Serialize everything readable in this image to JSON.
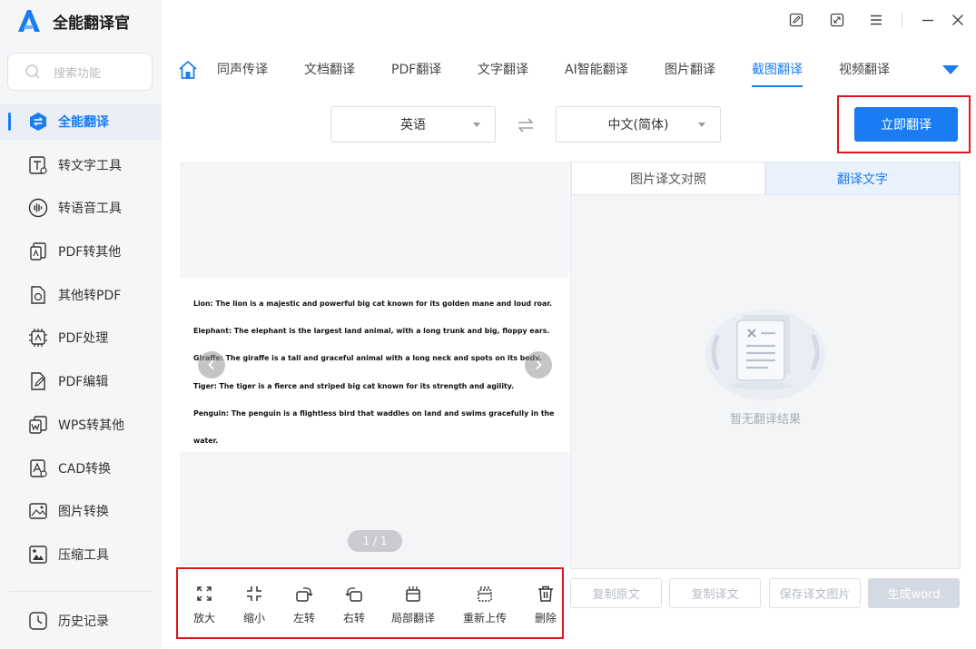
{
  "app": {
    "title": "全能翻译官"
  },
  "search": {
    "placeholder": "搜索功能"
  },
  "sidebar": {
    "items": [
      {
        "label": "全能翻译",
        "icon": "translate-icon",
        "active": true
      },
      {
        "label": "转文字工具",
        "icon": "text-convert-icon"
      },
      {
        "label": "转语音工具",
        "icon": "voice-icon"
      },
      {
        "label": "PDF转其他",
        "icon": "pdf-convert-icon"
      },
      {
        "label": "其他转PDF",
        "icon": "to-pdf-icon"
      },
      {
        "label": "PDF处理",
        "icon": "pdf-process-icon"
      },
      {
        "label": "PDF编辑",
        "icon": "pdf-edit-icon"
      },
      {
        "label": "WPS转其他",
        "icon": "wps-icon"
      },
      {
        "label": "CAD转换",
        "icon": "cad-icon"
      },
      {
        "label": "图片转换",
        "icon": "image-convert-icon"
      },
      {
        "label": "压缩工具",
        "icon": "compress-icon"
      }
    ],
    "history": {
      "label": "历史记录",
      "icon": "history-icon"
    }
  },
  "tabs": [
    {
      "label": "同声传译"
    },
    {
      "label": "文档翻译"
    },
    {
      "label": "PDF翻译"
    },
    {
      "label": "文字翻译"
    },
    {
      "label": "AI智能翻译"
    },
    {
      "label": "图片翻译"
    },
    {
      "label": "截图翻译",
      "active": true
    },
    {
      "label": "视频翻译"
    }
  ],
  "language": {
    "source": "英语",
    "target": "中文(简体)"
  },
  "translate_button": "立即翻译",
  "image": {
    "lines": [
      "Lion: The lion is a majestic and powerful big cat known for its golden mane and loud roar.",
      "Elephant: The elephant is the largest land animal, with a long trunk and big, floppy ears.",
      "Giraffe: The giraffe is a tall and graceful animal with a long neck and spots on its body.",
      "Tiger: The tiger is a fierce and striped big cat known for its strength and agility.",
      "Penguin: The penguin is a flightless bird that waddles on land and swims gracefully in the",
      "water."
    ],
    "pager": "1 / 1"
  },
  "toolbar": [
    {
      "label": "放大",
      "icon": "zoom-in-icon"
    },
    {
      "label": "缩小",
      "icon": "zoom-out-icon"
    },
    {
      "label": "左转",
      "icon": "rotate-left-icon"
    },
    {
      "label": "右转",
      "icon": "rotate-right-icon"
    },
    {
      "label": "局部翻译",
      "icon": "partial-translate-icon"
    },
    {
      "label": "重新上传",
      "icon": "reupload-icon"
    },
    {
      "label": "删除",
      "icon": "delete-icon"
    }
  ],
  "result": {
    "tabs": [
      {
        "label": "图片译文对照"
      },
      {
        "label": "翻译文字",
        "active": true
      }
    ],
    "empty_text": "暂无翻译结果",
    "actions": [
      {
        "label": "复制原文"
      },
      {
        "label": "复制译文"
      },
      {
        "label": "保存译文图片"
      },
      {
        "label": "生成word"
      }
    ]
  },
  "colors": {
    "accent": "#1a7cf2",
    "highlight_frame": "#e3141b"
  }
}
